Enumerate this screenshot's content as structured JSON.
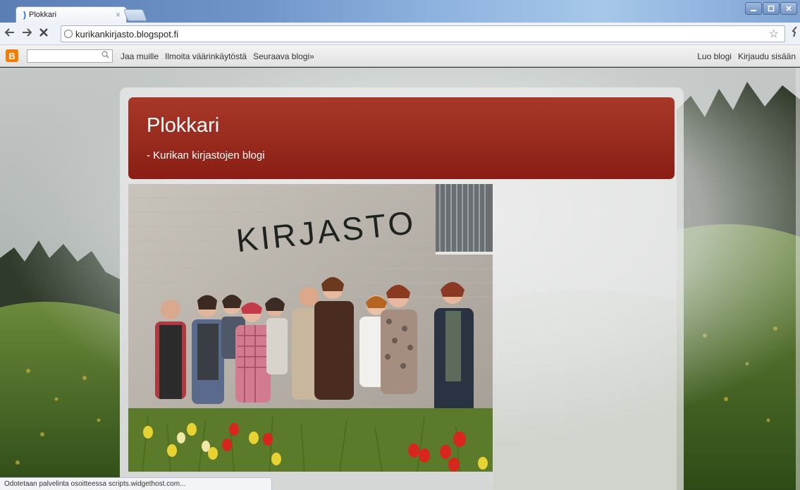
{
  "browser": {
    "tab_title": "Plokkari",
    "tab_close": "×",
    "url": "kurikankirjasto.blogspot.fi",
    "status_text": "Odotetaan palvelinta osoitteessa scripts.widgethost.com..."
  },
  "blog_navbar": {
    "logo": "B",
    "search_value": "",
    "links": [
      "Jaa muille",
      "Ilmoita väärinkäytöstä",
      "Seuraava blogi»"
    ],
    "right_links": [
      "Luo blogi",
      "Kirjaudu sisään"
    ]
  },
  "blog": {
    "title": "Plokkari",
    "description": "- Kurikan kirjastojen blogi",
    "photo_sign_text": "KIRJASTO"
  },
  "colors": {
    "header_red": "#9a2a1c",
    "blogger_orange": "#f57d00"
  }
}
